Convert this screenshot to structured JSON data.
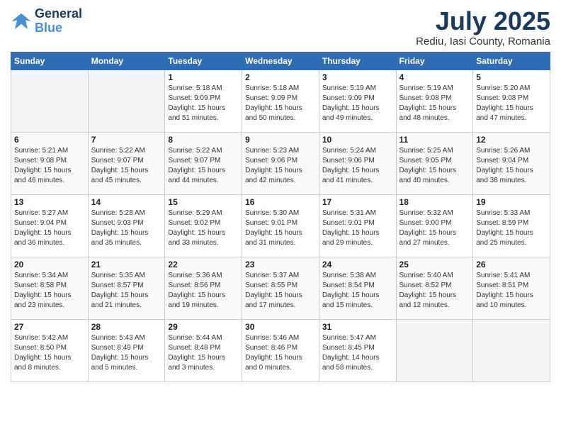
{
  "logo": {
    "text_general": "General",
    "text_blue": "Blue"
  },
  "header": {
    "month": "July 2025",
    "location": "Rediu, Iasi County, Romania"
  },
  "weekdays": [
    "Sunday",
    "Monday",
    "Tuesday",
    "Wednesday",
    "Thursday",
    "Friday",
    "Saturday"
  ],
  "weeks": [
    [
      {
        "day": "",
        "empty": true
      },
      {
        "day": "",
        "empty": true
      },
      {
        "day": "1",
        "sunrise": "5:18 AM",
        "sunset": "9:09 PM",
        "daylight": "15 hours and 51 minutes."
      },
      {
        "day": "2",
        "sunrise": "5:18 AM",
        "sunset": "9:09 PM",
        "daylight": "15 hours and 50 minutes."
      },
      {
        "day": "3",
        "sunrise": "5:19 AM",
        "sunset": "9:09 PM",
        "daylight": "15 hours and 49 minutes."
      },
      {
        "day": "4",
        "sunrise": "5:19 AM",
        "sunset": "9:08 PM",
        "daylight": "15 hours and 48 minutes."
      },
      {
        "day": "5",
        "sunrise": "5:20 AM",
        "sunset": "9:08 PM",
        "daylight": "15 hours and 47 minutes."
      }
    ],
    [
      {
        "day": "6",
        "sunrise": "5:21 AM",
        "sunset": "9:08 PM",
        "daylight": "15 hours and 46 minutes."
      },
      {
        "day": "7",
        "sunrise": "5:22 AM",
        "sunset": "9:07 PM",
        "daylight": "15 hours and 45 minutes."
      },
      {
        "day": "8",
        "sunrise": "5:22 AM",
        "sunset": "9:07 PM",
        "daylight": "15 hours and 44 minutes."
      },
      {
        "day": "9",
        "sunrise": "5:23 AM",
        "sunset": "9:06 PM",
        "daylight": "15 hours and 42 minutes."
      },
      {
        "day": "10",
        "sunrise": "5:24 AM",
        "sunset": "9:06 PM",
        "daylight": "15 hours and 41 minutes."
      },
      {
        "day": "11",
        "sunrise": "5:25 AM",
        "sunset": "9:05 PM",
        "daylight": "15 hours and 40 minutes."
      },
      {
        "day": "12",
        "sunrise": "5:26 AM",
        "sunset": "9:04 PM",
        "daylight": "15 hours and 38 minutes."
      }
    ],
    [
      {
        "day": "13",
        "sunrise": "5:27 AM",
        "sunset": "9:04 PM",
        "daylight": "15 hours and 36 minutes."
      },
      {
        "day": "14",
        "sunrise": "5:28 AM",
        "sunset": "9:03 PM",
        "daylight": "15 hours and 35 minutes."
      },
      {
        "day": "15",
        "sunrise": "5:29 AM",
        "sunset": "9:02 PM",
        "daylight": "15 hours and 33 minutes."
      },
      {
        "day": "16",
        "sunrise": "5:30 AM",
        "sunset": "9:01 PM",
        "daylight": "15 hours and 31 minutes."
      },
      {
        "day": "17",
        "sunrise": "5:31 AM",
        "sunset": "9:01 PM",
        "daylight": "15 hours and 29 minutes."
      },
      {
        "day": "18",
        "sunrise": "5:32 AM",
        "sunset": "9:00 PM",
        "daylight": "15 hours and 27 minutes."
      },
      {
        "day": "19",
        "sunrise": "5:33 AM",
        "sunset": "8:59 PM",
        "daylight": "15 hours and 25 minutes."
      }
    ],
    [
      {
        "day": "20",
        "sunrise": "5:34 AM",
        "sunset": "8:58 PM",
        "daylight": "15 hours and 23 minutes."
      },
      {
        "day": "21",
        "sunrise": "5:35 AM",
        "sunset": "8:57 PM",
        "daylight": "15 hours and 21 minutes."
      },
      {
        "day": "22",
        "sunrise": "5:36 AM",
        "sunset": "8:56 PM",
        "daylight": "15 hours and 19 minutes."
      },
      {
        "day": "23",
        "sunrise": "5:37 AM",
        "sunset": "8:55 PM",
        "daylight": "15 hours and 17 minutes."
      },
      {
        "day": "24",
        "sunrise": "5:38 AM",
        "sunset": "8:54 PM",
        "daylight": "15 hours and 15 minutes."
      },
      {
        "day": "25",
        "sunrise": "5:40 AM",
        "sunset": "8:52 PM",
        "daylight": "15 hours and 12 minutes."
      },
      {
        "day": "26",
        "sunrise": "5:41 AM",
        "sunset": "8:51 PM",
        "daylight": "15 hours and 10 minutes."
      }
    ],
    [
      {
        "day": "27",
        "sunrise": "5:42 AM",
        "sunset": "8:50 PM",
        "daylight": "15 hours and 8 minutes."
      },
      {
        "day": "28",
        "sunrise": "5:43 AM",
        "sunset": "8:49 PM",
        "daylight": "15 hours and 5 minutes."
      },
      {
        "day": "29",
        "sunrise": "5:44 AM",
        "sunset": "8:48 PM",
        "daylight": "15 hours and 3 minutes."
      },
      {
        "day": "30",
        "sunrise": "5:46 AM",
        "sunset": "8:46 PM",
        "daylight": "15 hours and 0 minutes."
      },
      {
        "day": "31",
        "sunrise": "5:47 AM",
        "sunset": "8:45 PM",
        "daylight": "14 hours and 58 minutes."
      },
      {
        "day": "",
        "empty": true
      },
      {
        "day": "",
        "empty": true
      }
    ]
  ]
}
